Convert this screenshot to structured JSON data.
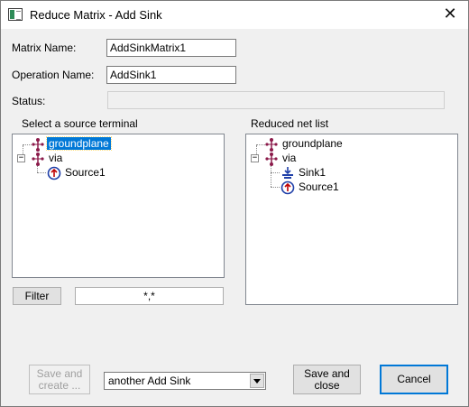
{
  "window": {
    "title": "Reduce Matrix - Add Sink"
  },
  "form": {
    "matrix_name_label": "Matrix Name:",
    "matrix_name_value": "AddSinkMatrix1",
    "operation_name_label": "Operation Name:",
    "operation_name_value": "AddSink1",
    "status_label": "Status:",
    "status_value": ""
  },
  "source_panel": {
    "label": "Select a source terminal",
    "nodes": [
      {
        "label": "groundplane",
        "icon": "net-icon",
        "selected": true
      },
      {
        "label": "via",
        "icon": "net-icon",
        "expanded": true
      },
      {
        "label": "Source1",
        "icon": "source-terminal-icon"
      }
    ]
  },
  "reduced_panel": {
    "label": "Reduced net list",
    "nodes": [
      {
        "label": "groundplane",
        "icon": "net-icon"
      },
      {
        "label": "via",
        "icon": "net-icon",
        "expanded": true
      },
      {
        "label": "Sink1",
        "icon": "sink-icon"
      },
      {
        "label": "Source1",
        "icon": "source-terminal-icon"
      }
    ]
  },
  "filter": {
    "button_label": "Filter",
    "value": "*,*"
  },
  "footer": {
    "save_create_label": "Save and create ...",
    "combo_value": "another Add Sink",
    "save_close_label": "Save and close",
    "cancel_label": "Cancel"
  }
}
